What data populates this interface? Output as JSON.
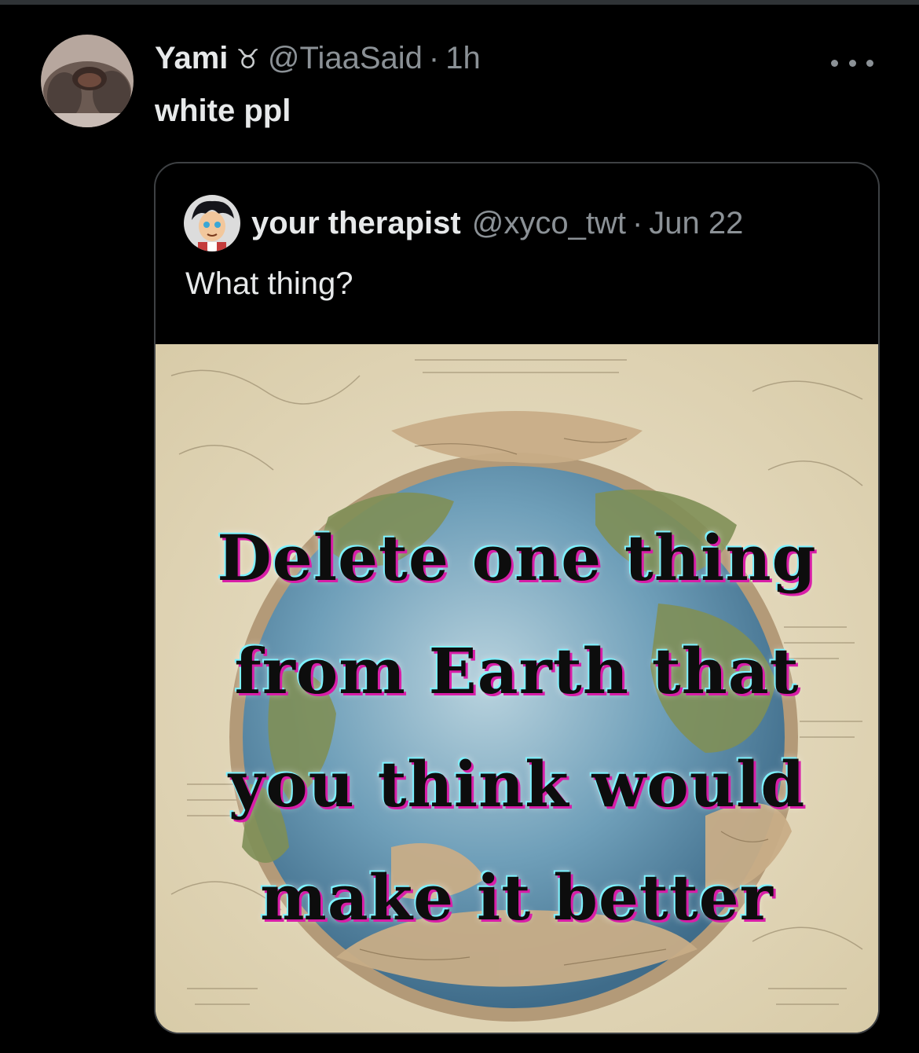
{
  "tweet": {
    "author": {
      "display_name": "Yami",
      "badge_emoji": "♉",
      "handle": "@TiaaSaid",
      "separator": "·",
      "time": "1h"
    },
    "text": "white ppl",
    "more_icon": "more-horizontal-icon"
  },
  "quoted_tweet": {
    "author": {
      "display_name": "your therapist",
      "handle": "@xyco_twt",
      "separator": "·",
      "date": "Jun 22"
    },
    "text": "What thing?",
    "media": {
      "overlay_lines": [
        "Delete one thing",
        "from Earth that",
        "you think would",
        "make it better"
      ]
    }
  },
  "colors": {
    "background": "#000000",
    "text_primary": "#e7e9ea",
    "text_secondary": "#8b9196",
    "border": "#3e4144"
  }
}
